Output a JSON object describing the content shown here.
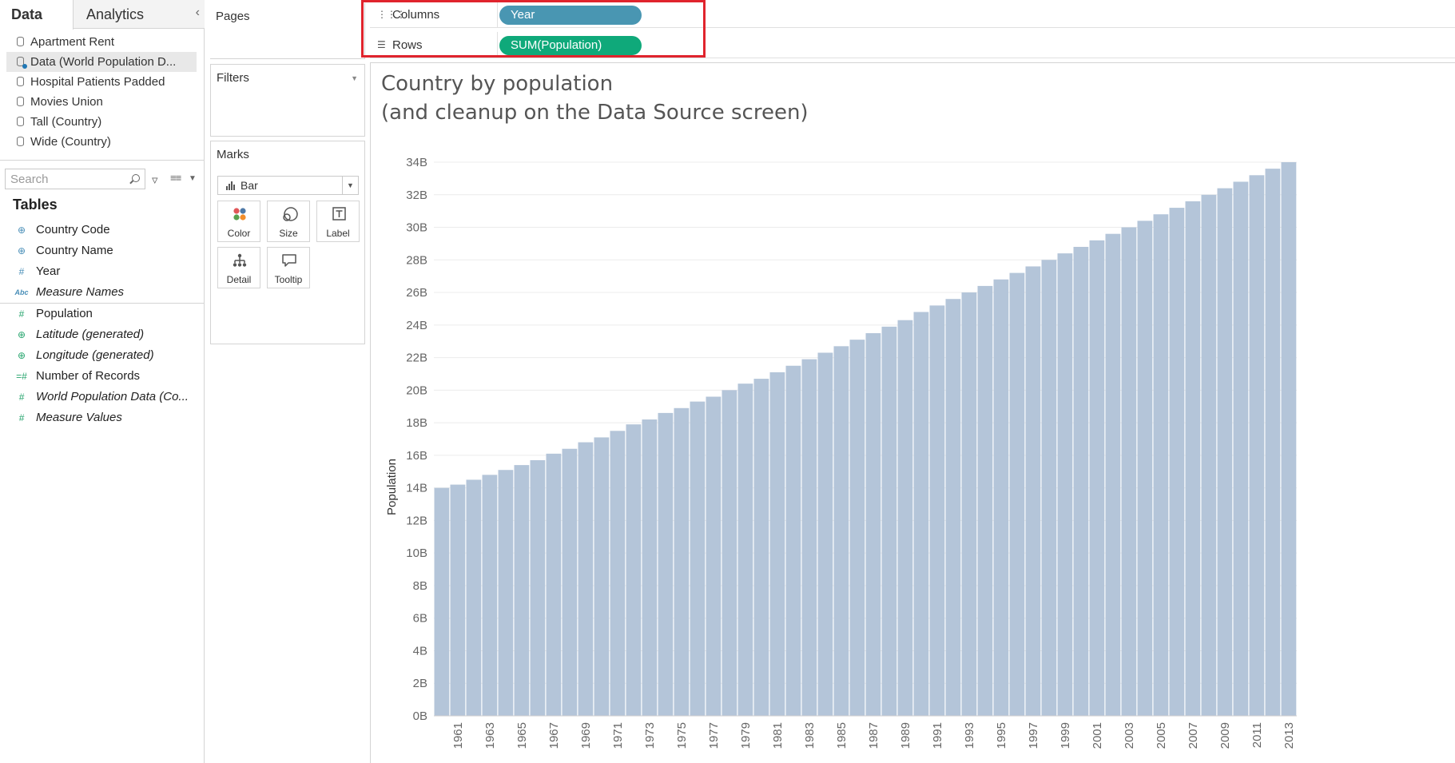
{
  "left_pane": {
    "tabs": [
      {
        "label": "Data"
      },
      {
        "label": "Analytics"
      }
    ],
    "collapse_glyph": "‹",
    "data_sources": [
      {
        "label": "Apartment Rent"
      },
      {
        "label": "Data (World Population D..."
      },
      {
        "label": "Hospital Patients Padded"
      },
      {
        "label": "Movies Union"
      },
      {
        "label": "Tall (Country)"
      },
      {
        "label": "Wide (Country)"
      }
    ],
    "search_placeholder": "Search",
    "tables_header": "Tables",
    "dimensions": [
      {
        "label": "Country Code",
        "icon": "globe-icon",
        "italic": false
      },
      {
        "label": "Country Name",
        "icon": "globe-icon",
        "italic": false
      },
      {
        "label": "Year",
        "icon": "hash-icon",
        "italic": false
      },
      {
        "label": "Measure Names",
        "icon": "abc-icon",
        "italic": true
      }
    ],
    "measures": [
      {
        "label": "Population",
        "icon": "hash-icon",
        "italic": false
      },
      {
        "label": "Latitude (generated)",
        "icon": "globe-icon",
        "italic": true
      },
      {
        "label": "Longitude (generated)",
        "icon": "globe-icon",
        "italic": true
      },
      {
        "label": "Number of Records",
        "icon": "hash-icon",
        "italic": false
      },
      {
        "label": "World Population Data (Co...",
        "icon": "hash-icon",
        "italic": true
      },
      {
        "label": "Measure Values",
        "icon": "hash-icon",
        "italic": true
      }
    ]
  },
  "cards": {
    "pages": "Pages",
    "filters": "Filters",
    "marks": "Marks",
    "mark_type": "Bar",
    "mark_buttons": [
      {
        "label": "Color",
        "icon": "color-icon"
      },
      {
        "label": "Size",
        "icon": "size-icon"
      },
      {
        "label": "Label",
        "icon": "label-icon"
      },
      {
        "label": "Detail",
        "icon": "detail-icon"
      },
      {
        "label": "Tooltip",
        "icon": "tooltip-icon"
      }
    ]
  },
  "shelves": {
    "columns_label": "Columns",
    "columns_pill": "Year",
    "rows_label": "Rows",
    "rows_pill": "SUM(Population)"
  },
  "colors": {
    "bar": "#b4c5d9",
    "year_pill": "#4996b2",
    "population_pill": "#0fa97a",
    "highlight": "#e0242d"
  },
  "viz": {
    "title_line1": "Country by population",
    "title_line2": "(and cleanup on the Data Source screen)"
  },
  "chart_data": {
    "type": "bar",
    "title": "Country by population\n(and cleanup on the Data Source screen)",
    "ylabel": "Population",
    "xlabel": "",
    "ylim": [
      0,
      34
    ],
    "y_unit": "B",
    "y_ticks": [
      "0B",
      "2B",
      "4B",
      "6B",
      "8B",
      "10B",
      "12B",
      "14B",
      "16B",
      "18B",
      "20B",
      "22B",
      "24B",
      "26B",
      "28B",
      "30B",
      "32B",
      "34B"
    ],
    "x_tick_labels": [
      "1961",
      "1963",
      "1965",
      "1967",
      "1969",
      "1971",
      "1973",
      "1975",
      "1977",
      "1979",
      "1981",
      "1983",
      "1985",
      "1987",
      "1989",
      "1991",
      "1993",
      "1995",
      "1997",
      "1999",
      "2001",
      "2003",
      "2005",
      "2007",
      "2009",
      "2011",
      "2013"
    ],
    "categories": [
      1960,
      1961,
      1962,
      1963,
      1964,
      1965,
      1966,
      1967,
      1968,
      1969,
      1970,
      1971,
      1972,
      1973,
      1974,
      1975,
      1976,
      1977,
      1978,
      1979,
      1980,
      1981,
      1982,
      1983,
      1984,
      1985,
      1986,
      1987,
      1988,
      1989,
      1990,
      1991,
      1992,
      1993,
      1994,
      1995,
      1996,
      1997,
      1998,
      1999,
      2000,
      2001,
      2002,
      2003,
      2004,
      2005,
      2006,
      2007,
      2008,
      2009,
      2010,
      2011,
      2012,
      2013
    ],
    "values": [
      14.0,
      14.2,
      14.5,
      14.8,
      15.1,
      15.4,
      15.7,
      16.1,
      16.4,
      16.8,
      17.1,
      17.5,
      17.9,
      18.2,
      18.6,
      18.9,
      19.3,
      19.6,
      20.0,
      20.4,
      20.7,
      21.1,
      21.5,
      21.9,
      22.3,
      22.7,
      23.1,
      23.5,
      23.9,
      24.3,
      24.8,
      25.2,
      25.6,
      26.0,
      26.4,
      26.8,
      27.2,
      27.6,
      28.0,
      28.4,
      28.8,
      29.2,
      29.6,
      30.0,
      30.4,
      30.8,
      31.2,
      31.6,
      32.0,
      32.4,
      32.8,
      33.2,
      33.6,
      34.0
    ],
    "grid": true,
    "legend": "none"
  }
}
